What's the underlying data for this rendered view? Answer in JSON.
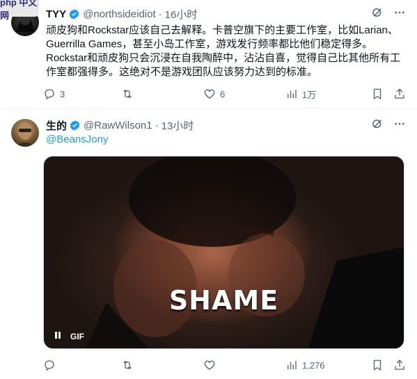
{
  "watermark": {
    "text": "php 中文网"
  },
  "tweets": [
    {
      "name": "TYY",
      "handle": "@northsideidiot",
      "time": "16小时",
      "text": "顽皮狗和Rockstar应该自己去解释。卡普空旗下的主要工作室，比如Larian、Guerrilla Games，甚至小岛工作室，游戏发行频率都比他们稳定得多。Rockstar和顽皮狗只会沉浸在自我陶醉中，沾沾自喜，觉得自己比其他所有工作室都强得多。这绝对不是游戏团队应该努力达到的标准。",
      "replies": "3",
      "retweets": "",
      "likes": "6",
      "views": "1万"
    },
    {
      "name": "生的",
      "handle": "@RawWilson1",
      "time": "13小时",
      "reply_to": "@BeansJony",
      "media_caption": "SHAME",
      "gif_label": "GIF",
      "replies": "",
      "retweets": "",
      "likes": "",
      "views": "1,276"
    }
  ],
  "colors": {
    "verified": "#1d9bf0",
    "link": "#1d9bf0",
    "muted": "#536471"
  }
}
